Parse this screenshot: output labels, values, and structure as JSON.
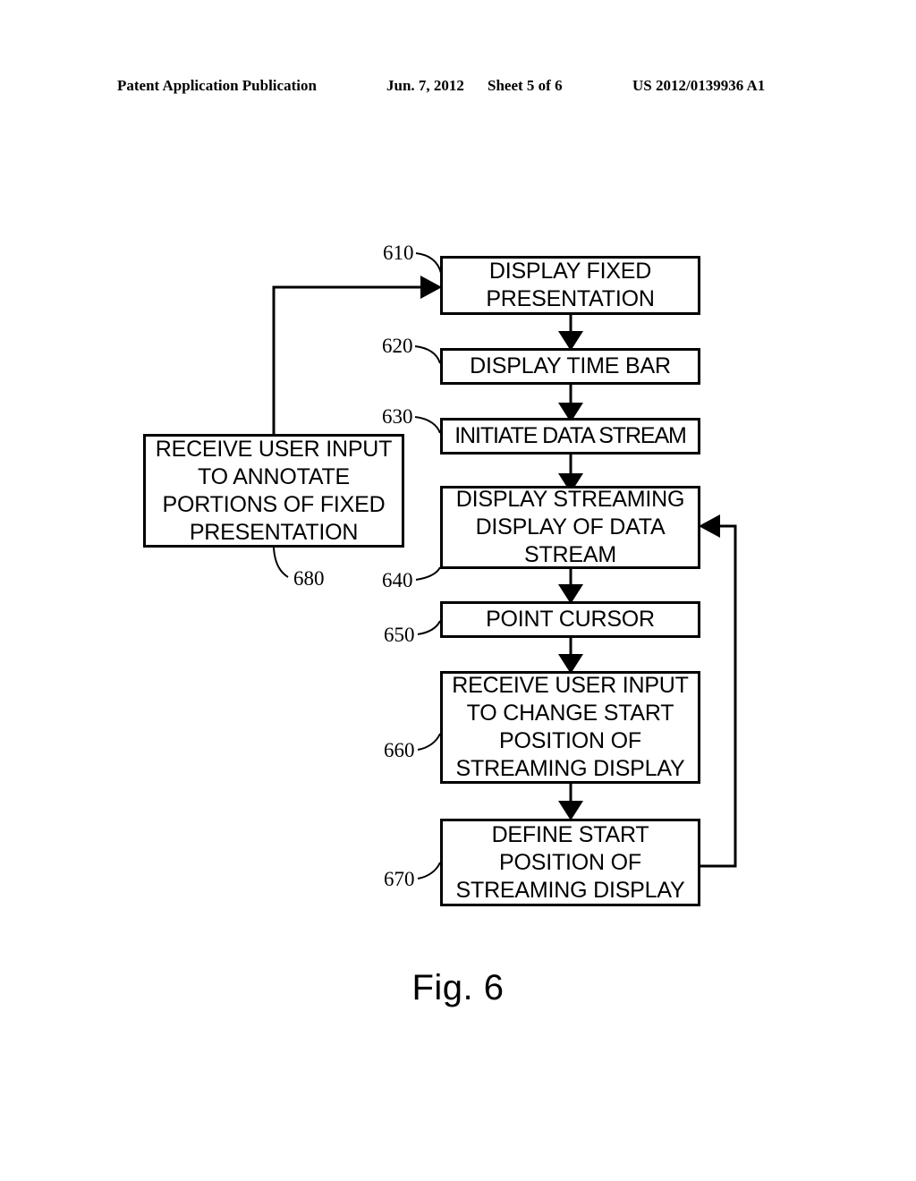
{
  "header": {
    "left": "Patent Application Publication",
    "date": "Jun. 7, 2012",
    "sheet": "Sheet 5 of 6",
    "publication_number": "US 2012/0139936 A1"
  },
  "figure": {
    "caption": "Fig. 6",
    "nodes": [
      {
        "ref": "610",
        "text": "DISPLAY FIXED\nPRESENTATION"
      },
      {
        "ref": "620",
        "text": "DISPLAY TIME BAR"
      },
      {
        "ref": "630",
        "text": "INITIATE DATA STREAM"
      },
      {
        "ref": "640",
        "text": "DISPLAY STREAMING\nDISPLAY OF DATA\nSTREAM"
      },
      {
        "ref": "650",
        "text": "POINT CURSOR"
      },
      {
        "ref": "660",
        "text": "RECEIVE USER INPUT\nTO CHANGE START\nPOSITION OF\nSTREAMING DISPLAY"
      },
      {
        "ref": "670",
        "text": "DEFINE START\nPOSITION OF\nSTREAMING DISPLAY"
      },
      {
        "ref": "680",
        "text": "RECEIVE USER INPUT\nTO ANNOTATE\nPORTIONS OF FIXED\nPRESENTATION"
      }
    ]
  },
  "colors": {
    "ink": "#000000",
    "paper": "#ffffff"
  }
}
